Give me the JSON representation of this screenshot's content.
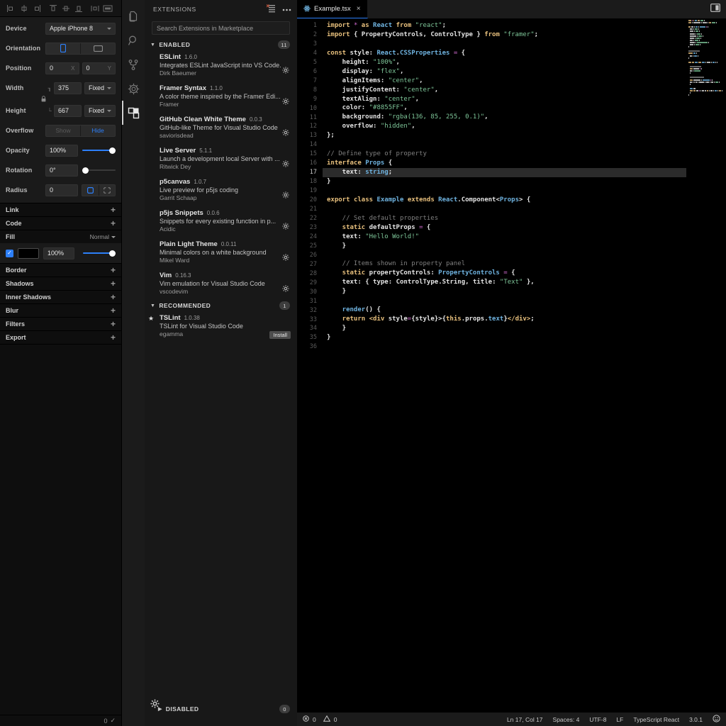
{
  "framer": {
    "toolbar_icons": [
      "align-left-icon",
      "align-center-horizontal-icon",
      "align-right-icon",
      "align-top-icon",
      "align-center-vertical-icon",
      "align-bottom-icon",
      "distribute-horizontal-icon",
      "distribute-vertical-icon"
    ],
    "properties": [
      {
        "label": "Device",
        "type": "select",
        "value": "Apple iPhone 8"
      },
      {
        "label": "Orientation",
        "type": "segment",
        "options": [
          "portrait-icon",
          "landscape-icon"
        ],
        "selected": 0
      },
      {
        "label": "Position",
        "type": "xy",
        "x": "0",
        "x_suffix": "X",
        "y": "0",
        "y_suffix": "Y"
      },
      {
        "label": "Width",
        "type": "size",
        "value": "375",
        "mode": "Fixed"
      },
      {
        "label": "Height",
        "type": "size",
        "value": "667",
        "mode": "Fixed"
      },
      {
        "label": "Overflow",
        "type": "segment_text",
        "options": [
          "Show",
          "Hide"
        ],
        "selected": 1
      },
      {
        "label": "Opacity",
        "type": "slider",
        "value": "100%",
        "percent": 100
      },
      {
        "label": "Rotation",
        "type": "slider",
        "value": "0°",
        "percent": 0
      },
      {
        "label": "Radius",
        "type": "radius",
        "value": "0"
      }
    ],
    "sections": [
      {
        "label": "Link",
        "action": "+"
      },
      {
        "label": "Code",
        "action": "+"
      }
    ],
    "fill": {
      "label": "Fill",
      "blend_mode": "Normal",
      "enabled": true,
      "color": "#000000",
      "opacity": "100%",
      "opacity_percent": 100
    },
    "sections_bottom": [
      {
        "label": "Border",
        "action": "+"
      },
      {
        "label": "Shadows",
        "action": "+"
      },
      {
        "label": "Inner Shadows",
        "action": "+"
      },
      {
        "label": "Blur",
        "action": "+"
      },
      {
        "label": "Filters",
        "action": "+"
      },
      {
        "label": "Export",
        "action": "+"
      }
    ],
    "footer": {
      "count": "0",
      "check": "✓"
    }
  },
  "activitybar": {
    "items": [
      {
        "name": "explorer-icon",
        "active": false
      },
      {
        "name": "search-icon",
        "active": false
      },
      {
        "name": "source-control-icon",
        "active": false
      },
      {
        "name": "debug-icon",
        "active": false
      },
      {
        "name": "extensions-icon",
        "active": true
      }
    ]
  },
  "sidebar": {
    "title": "EXTENSIONS",
    "header_actions": [
      "clear-filter-icon",
      "more-actions-icon"
    ],
    "search": {
      "placeholder": "Search Extensions in Marketplace",
      "value": ""
    },
    "groups": [
      {
        "label": "ENABLED",
        "count": "11",
        "expanded": true,
        "items": [
          {
            "name": "ESLint",
            "version": "1.6.0",
            "description": "Integrates ESLint JavaScript into VS Code.",
            "publisher": "Dirk Baeumer",
            "action": "gear"
          },
          {
            "name": "Framer Syntax",
            "version": "1.1.0",
            "description": "A color theme inspired by the Framer Edi...",
            "publisher": "Framer",
            "action": "gear"
          },
          {
            "name": "GitHub Clean White Theme",
            "version": "0.0.3",
            "description": "GitHub-like Theme for Visual Studio Code",
            "publisher": "saviorisdead",
            "action": "gear"
          },
          {
            "name": "Live Server",
            "version": "5.1.1",
            "description": "Launch a development local Server with ...",
            "publisher": "Ritwick Dey",
            "action": "gear"
          },
          {
            "name": "p5canvas",
            "version": "1.0.7",
            "description": "Live preview for p5js coding",
            "publisher": "Garrit Schaap",
            "action": "gear"
          },
          {
            "name": "p5js Snippets",
            "version": "0.0.6",
            "description": "Snippets for every existing function in p...",
            "publisher": "Acidic",
            "action": "gear"
          },
          {
            "name": "Plain Light Theme",
            "version": "0.0.11",
            "description": "Minimal colors on a white background",
            "publisher": "Mikel Ward",
            "action": "gear"
          },
          {
            "name": "Vim",
            "version": "0.16.3",
            "description": "Vim emulation for Visual Studio Code",
            "publisher": "vscodevim",
            "action": "gear"
          }
        ]
      },
      {
        "label": "RECOMMENDED",
        "count": "1",
        "expanded": true,
        "items": [
          {
            "name": "TSLint",
            "version": "1.0.38",
            "description": "TSLint for Visual Studio Code",
            "publisher": "egamma",
            "action": "install",
            "action_label": "Install",
            "starred": true
          }
        ]
      }
    ],
    "disabled_group": {
      "label": "DISABLED",
      "count": "0",
      "expanded": false
    }
  },
  "editor": {
    "tab": {
      "filename": "Example.tsx",
      "icon": "react-file-icon",
      "close": "×",
      "dirty": false
    },
    "tab_right_icon": "split-editor-icon",
    "cursor_line": 17,
    "total_lines": 36,
    "lines": [
      {
        "n": 1,
        "tokens": [
          [
            "import ",
            "kw"
          ],
          [
            "* ",
            "op"
          ],
          [
            "as ",
            "kw"
          ],
          [
            "React ",
            "cls"
          ],
          [
            "from ",
            "kw"
          ],
          [
            "\"react\"",
            "str"
          ],
          [
            ";",
            "pl"
          ]
        ]
      },
      {
        "n": 2,
        "tokens": [
          [
            "import ",
            "kw"
          ],
          [
            "{ ",
            "pl"
          ],
          [
            "PropertyControls",
            "pl"
          ],
          [
            ", ",
            "pl"
          ],
          [
            "ControlType ",
            "pl"
          ],
          [
            "} ",
            "pl"
          ],
          [
            "from ",
            "kw"
          ],
          [
            "\"framer\"",
            "str"
          ],
          [
            ";",
            "pl"
          ]
        ]
      },
      {
        "n": 3,
        "tokens": []
      },
      {
        "n": 4,
        "tokens": [
          [
            "const ",
            "kw"
          ],
          [
            "style",
            "pl"
          ],
          [
            ": ",
            "pl"
          ],
          [
            "React",
            "cls"
          ],
          [
            ".",
            "pl"
          ],
          [
            "CSSProperties ",
            "cls"
          ],
          [
            "= ",
            "op"
          ],
          [
            "{",
            "pl"
          ]
        ]
      },
      {
        "n": 5,
        "tokens": [
          [
            "    height",
            "pl"
          ],
          [
            ": ",
            "pl"
          ],
          [
            "\"100%\"",
            "str"
          ],
          [
            ",",
            "pl"
          ]
        ]
      },
      {
        "n": 6,
        "tokens": [
          [
            "    display",
            "pl"
          ],
          [
            ": ",
            "pl"
          ],
          [
            "\"flex\"",
            "str"
          ],
          [
            ",",
            "pl"
          ]
        ]
      },
      {
        "n": 7,
        "tokens": [
          [
            "    alignItems",
            "pl"
          ],
          [
            ": ",
            "pl"
          ],
          [
            "\"center\"",
            "str"
          ],
          [
            ",",
            "pl"
          ]
        ]
      },
      {
        "n": 8,
        "tokens": [
          [
            "    justifyContent",
            "pl"
          ],
          [
            ": ",
            "pl"
          ],
          [
            "\"center\"",
            "str"
          ],
          [
            ",",
            "pl"
          ]
        ]
      },
      {
        "n": 9,
        "tokens": [
          [
            "    textAlign",
            "pl"
          ],
          [
            ": ",
            "pl"
          ],
          [
            "\"center\"",
            "str"
          ],
          [
            ",",
            "pl"
          ]
        ]
      },
      {
        "n": 10,
        "tokens": [
          [
            "    color",
            "pl"
          ],
          [
            ": ",
            "pl"
          ],
          [
            "\"#8855FF\"",
            "str"
          ],
          [
            ",",
            "pl"
          ]
        ]
      },
      {
        "n": 11,
        "tokens": [
          [
            "    background",
            "pl"
          ],
          [
            ": ",
            "pl"
          ],
          [
            "\"rgba(136, 85, 255, 0.1)\"",
            "str"
          ],
          [
            ",",
            "pl"
          ]
        ]
      },
      {
        "n": 12,
        "tokens": [
          [
            "    overflow",
            "pl"
          ],
          [
            ": ",
            "pl"
          ],
          [
            "\"hidden\"",
            "str"
          ],
          [
            ",",
            "pl"
          ]
        ]
      },
      {
        "n": 13,
        "tokens": [
          [
            "};",
            "pl"
          ]
        ]
      },
      {
        "n": 14,
        "tokens": []
      },
      {
        "n": 15,
        "tokens": [
          [
            "// Define type of property",
            "cmt"
          ]
        ]
      },
      {
        "n": 16,
        "tokens": [
          [
            "interface ",
            "kw"
          ],
          [
            "Props ",
            "cls"
          ],
          [
            "{",
            "pl"
          ]
        ]
      },
      {
        "n": 17,
        "tokens": [
          [
            "    text",
            "pl"
          ],
          [
            ": ",
            "pl"
          ],
          [
            "string",
            "cls"
          ],
          [
            ";",
            "pl"
          ]
        ],
        "highlight": true
      },
      {
        "n": 18,
        "tokens": [
          [
            "}",
            "pl"
          ]
        ]
      },
      {
        "n": 19,
        "tokens": []
      },
      {
        "n": 20,
        "tokens": [
          [
            "export ",
            "kw"
          ],
          [
            "class ",
            "kw"
          ],
          [
            "Example ",
            "cls"
          ],
          [
            "extends ",
            "kw"
          ],
          [
            "React",
            "cls"
          ],
          [
            ".",
            "pl"
          ],
          [
            "Component",
            "pl"
          ],
          [
            "<",
            "pl"
          ],
          [
            "Props",
            "cls"
          ],
          [
            "> ",
            "pl"
          ],
          [
            "{",
            "pl"
          ]
        ]
      },
      {
        "n": 21,
        "tokens": []
      },
      {
        "n": 22,
        "tokens": [
          [
            "    // Set default properties",
            "cmt"
          ]
        ]
      },
      {
        "n": 23,
        "tokens": [
          [
            "    static ",
            "kw"
          ],
          [
            "defaultProps ",
            "pl"
          ],
          [
            "= ",
            "op"
          ],
          [
            "{",
            "pl"
          ]
        ]
      },
      {
        "n": 24,
        "tokens": [
          [
            "    text",
            "pl"
          ],
          [
            ": ",
            "pl"
          ],
          [
            "\"Hello World!\"",
            "str"
          ]
        ]
      },
      {
        "n": 25,
        "tokens": [
          [
            "    }",
            "pl"
          ]
        ]
      },
      {
        "n": 26,
        "tokens": []
      },
      {
        "n": 27,
        "tokens": [
          [
            "    // Items shown in property panel",
            "cmt"
          ]
        ]
      },
      {
        "n": 28,
        "tokens": [
          [
            "    static ",
            "kw"
          ],
          [
            "propertyControls",
            "pl"
          ],
          [
            ": ",
            "pl"
          ],
          [
            "PropertyControls ",
            "cls"
          ],
          [
            "= ",
            "op"
          ],
          [
            "{",
            "pl"
          ]
        ]
      },
      {
        "n": 29,
        "tokens": [
          [
            "    text",
            "pl"
          ],
          [
            ": ",
            "pl"
          ],
          [
            "{ ",
            "pl"
          ],
          [
            "type",
            "pl"
          ],
          [
            ": ",
            "pl"
          ],
          [
            "ControlType",
            "pl"
          ],
          [
            ".",
            "pl"
          ],
          [
            "String",
            "pl"
          ],
          [
            ", ",
            "pl"
          ],
          [
            "title",
            "pl"
          ],
          [
            ": ",
            "pl"
          ],
          [
            "\"Text\" ",
            "str"
          ],
          [
            "},",
            "pl"
          ]
        ]
      },
      {
        "n": 30,
        "tokens": [
          [
            "    }",
            "pl"
          ]
        ]
      },
      {
        "n": 31,
        "tokens": []
      },
      {
        "n": 32,
        "tokens": [
          [
            "    render",
            "fn"
          ],
          [
            "() {",
            "pl"
          ]
        ]
      },
      {
        "n": 33,
        "tokens": [
          [
            "    return ",
            "kw"
          ],
          [
            "<div ",
            "tag"
          ],
          [
            "style",
            "pl"
          ],
          [
            "=",
            "op"
          ],
          [
            "{",
            "pl"
          ],
          [
            "style",
            "pl"
          ],
          [
            "}>{",
            "pl"
          ],
          [
            "this",
            "kw2"
          ],
          [
            ".",
            "pl"
          ],
          [
            "props",
            "pl"
          ],
          [
            ".",
            "pl"
          ],
          [
            "text",
            "cls"
          ],
          [
            "}",
            "pl"
          ],
          [
            "</div>",
            "tag"
          ],
          [
            ";",
            "pl"
          ]
        ]
      },
      {
        "n": 34,
        "tokens": [
          [
            "    }",
            "pl"
          ]
        ]
      },
      {
        "n": 35,
        "tokens": [
          [
            "}",
            "pl"
          ]
        ]
      },
      {
        "n": 36,
        "tokens": []
      }
    ]
  },
  "statusbar": {
    "errors_icon": "error-icon",
    "errors": "0",
    "warnings_icon": "warning-icon",
    "warnings": "0",
    "position": "Ln 17, Col 17",
    "indent": "Spaces: 4",
    "encoding": "UTF-8",
    "eol": "LF",
    "language": "TypeScript React",
    "version": "3.0.1",
    "feedback_icon": "smiley-icon"
  },
  "colors": {
    "accent": "#2d7ff9",
    "keyword": "#e8c07d",
    "string": "#7ec699",
    "comment": "#7a7a7a",
    "class": "#6fb3e0",
    "operator": "#d16bd1",
    "plain": "#e4e4e4",
    "tab_active_border": "#2d7ff9"
  }
}
